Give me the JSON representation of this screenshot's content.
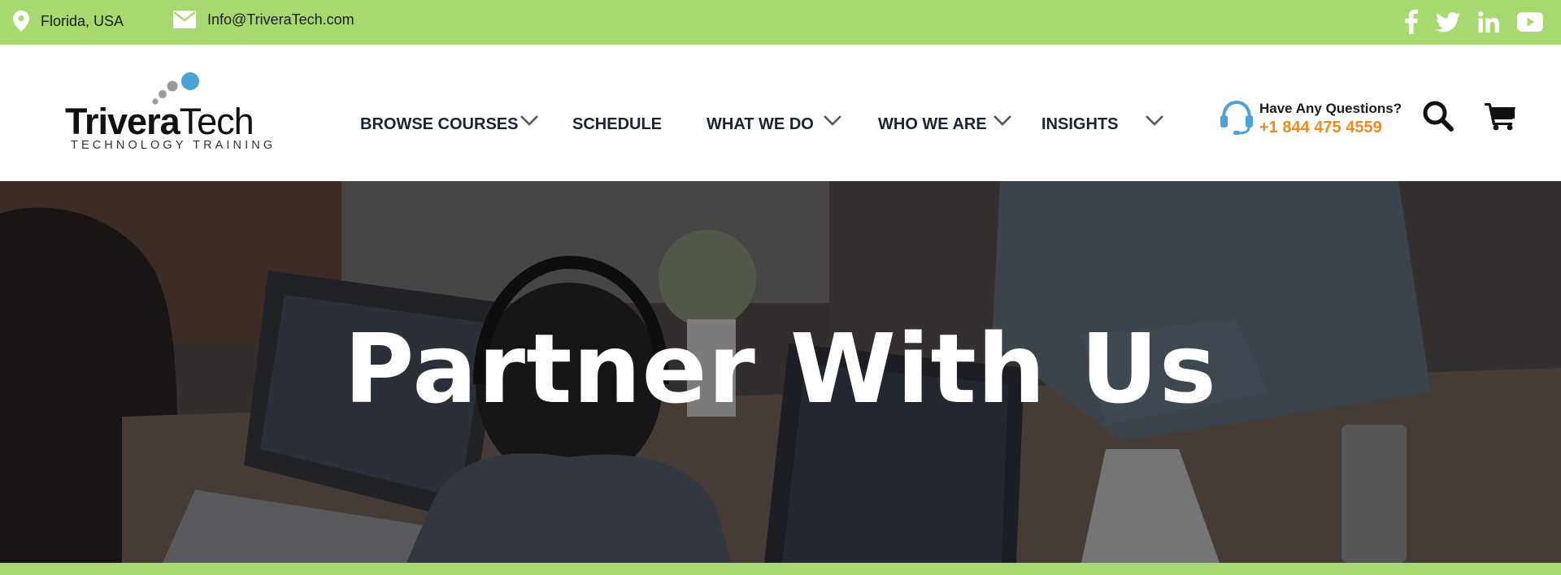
{
  "topbar": {
    "location": "Florida, USA",
    "email": "Info@TriveraTech.com",
    "background": "#a8d970",
    "social_icons": [
      "facebook-icon",
      "twitter-icon",
      "linkedin-icon",
      "youtube-icon"
    ]
  },
  "logo": {
    "word_bold": "Trivera",
    "word_light": "Tech",
    "tagline": "TECHNOLOGY TRAINING"
  },
  "nav": {
    "items": [
      {
        "label": "BROWSE COURSES",
        "has_dropdown": true
      },
      {
        "label": "SCHEDULE",
        "has_dropdown": false
      },
      {
        "label": "WHAT WE DO",
        "has_dropdown": true
      },
      {
        "label": "WHO WE ARE",
        "has_dropdown": true
      },
      {
        "label": "INSIGHTS",
        "has_dropdown": true
      }
    ]
  },
  "help": {
    "question": "Have Any Questions?",
    "phone": "+1 844 475 4559",
    "icon": "headset-icon",
    "phone_color": "#f0891e"
  },
  "header_icons": [
    "search-icon",
    "cart-icon"
  ],
  "hero": {
    "title": "Partner With Us"
  },
  "colors": {
    "accent_green": "#a8d970",
    "accent_orange": "#f0891e",
    "accent_blue": "#4aa3d4",
    "nav_text": "#1b2435"
  }
}
